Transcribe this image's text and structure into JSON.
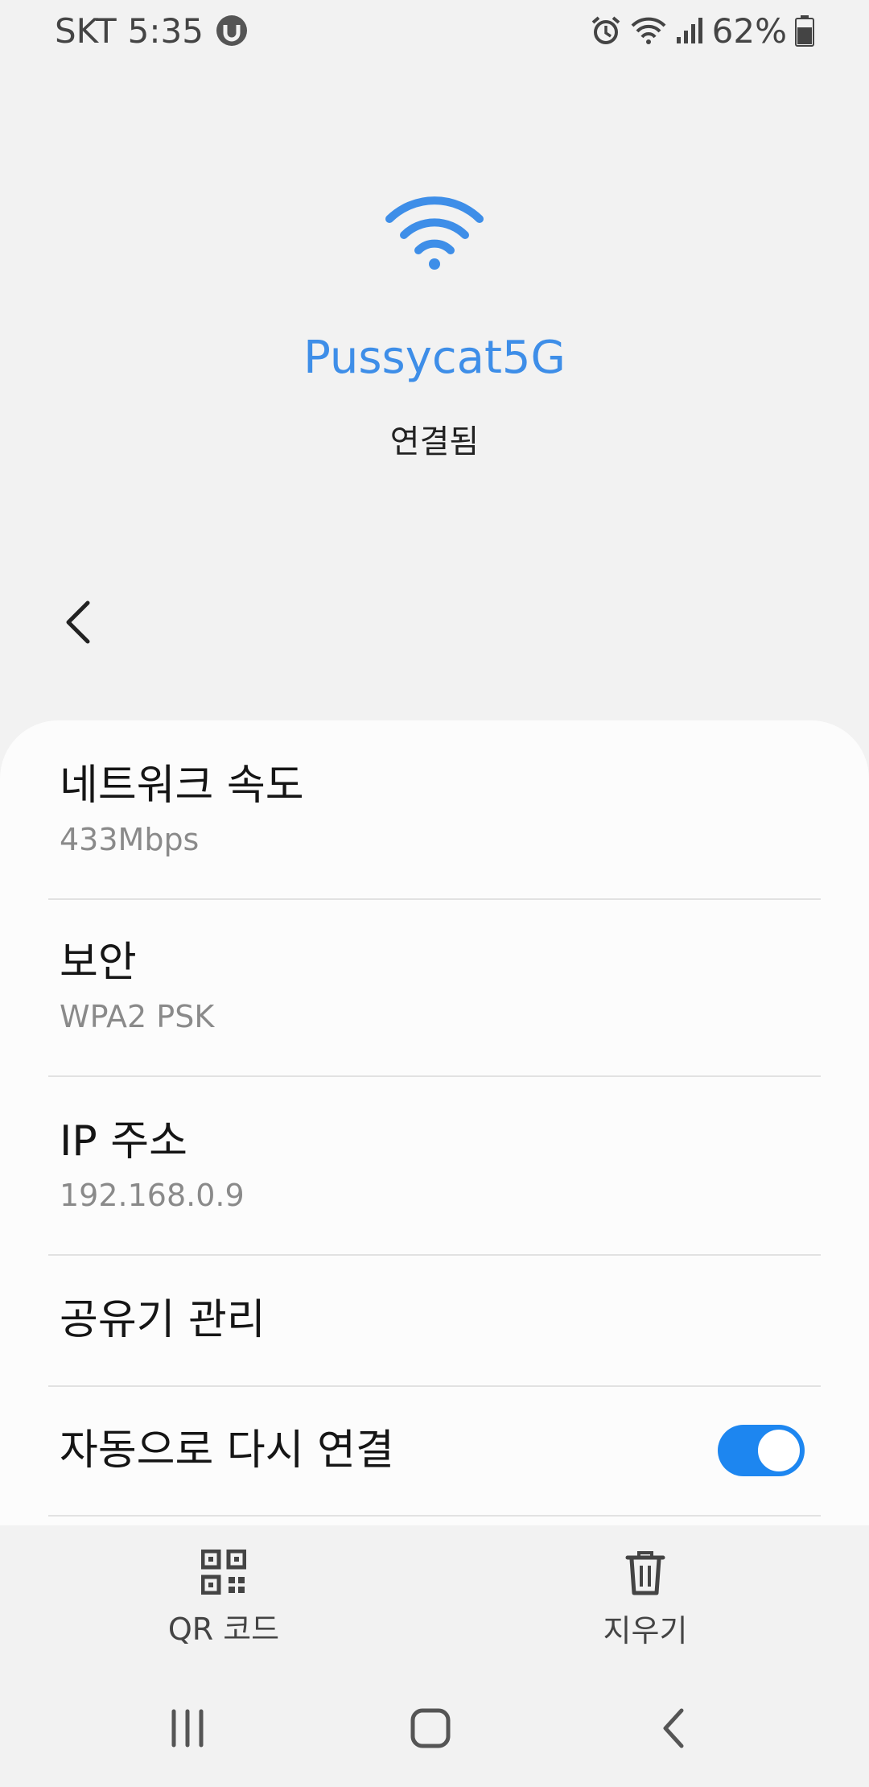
{
  "status_bar": {
    "carrier": "SKT",
    "time": "5:35",
    "battery": "62%"
  },
  "network": {
    "name": "Pussycat5G",
    "status": "연결됨"
  },
  "details": [
    {
      "title": "네트워크 속도",
      "value": "433Mbps"
    },
    {
      "title": "보안",
      "value": "WPA2 PSK"
    },
    {
      "title": "IP 주소",
      "value": "192.168.0.9"
    }
  ],
  "router_manage": {
    "title": "공유기 관리"
  },
  "auto_reconnect": {
    "title": "자동으로 다시 연결",
    "enabled": true
  },
  "actions": {
    "qr_label": "QR 코드",
    "forget_label": "지우기"
  },
  "colors": {
    "accent": "#3e8ee8",
    "toggle_on": "#1d86f0"
  }
}
